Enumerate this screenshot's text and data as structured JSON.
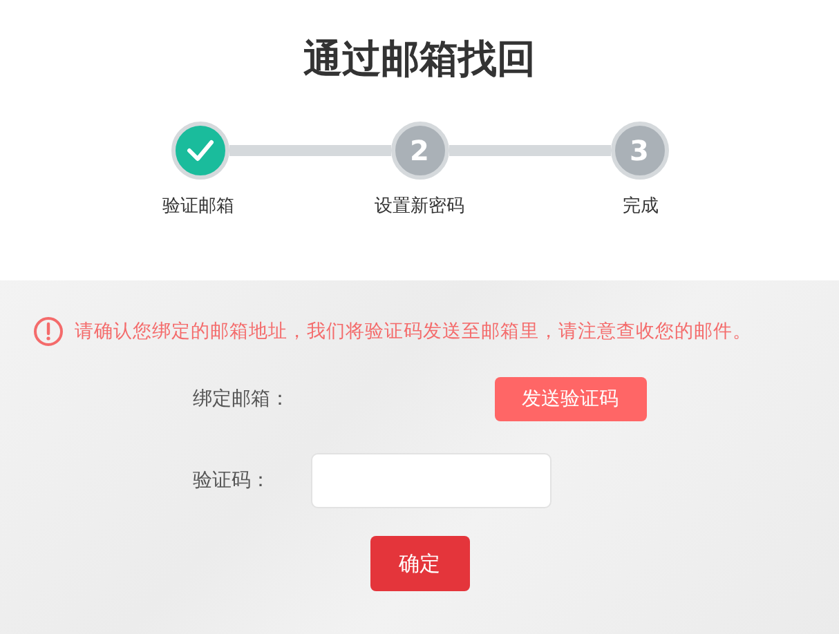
{
  "title": "通过邮箱找回",
  "steps": [
    {
      "label": "验证邮箱",
      "done": true
    },
    {
      "number": "2",
      "label": "设置新密码",
      "done": false
    },
    {
      "number": "3",
      "label": "完成",
      "done": false
    }
  ],
  "alert": {
    "message": "请确认您绑定的邮箱地址，我们将验证码发送至邮箱里，请注意查收您的邮件。"
  },
  "form": {
    "email_label": "绑定邮箱：",
    "send_button": "发送验证码",
    "code_label": "验证码："
  },
  "submit_button": "确定"
}
